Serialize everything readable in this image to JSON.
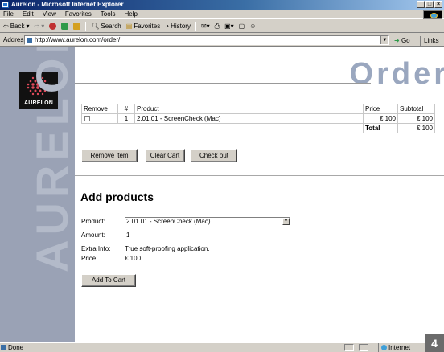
{
  "window": {
    "title": "Aurelon - Microsoft Internet Explorer",
    "controls": [
      "_",
      "□",
      "×"
    ]
  },
  "menu": [
    "File",
    "Edit",
    "View",
    "Favorites",
    "Tools",
    "Help"
  ],
  "toolbar": {
    "back": "Back",
    "search": "Search",
    "favorites": "Favorites",
    "history": "History"
  },
  "address": {
    "label": "Address",
    "url": "http://www.aurelon.com/order/",
    "go": "Go",
    "links": "Links »"
  },
  "brand": {
    "logo_text": "AURELON",
    "side_text": "AURELON",
    "colors": {
      "sidebar": "#9aa2b5",
      "title": "#9aa7bf"
    }
  },
  "page": {
    "title": "Order"
  },
  "cart": {
    "headers": [
      "Remove",
      "#",
      "Product",
      "Price",
      "Subtotal"
    ],
    "rows": [
      {
        "num": "1",
        "product": "2.01.01 - ScreenCheck (Mac)",
        "price": "€ 100",
        "subtotal": "€ 100"
      }
    ],
    "total_label": "Total",
    "total_value": "€ 100",
    "buttons": {
      "remove": "Remove item",
      "clear": "Clear Cart",
      "checkout": "Check out"
    }
  },
  "add_products": {
    "heading": "Add products",
    "product_label": "Product:",
    "product_value": "2.01.01 - ScreenCheck (Mac)",
    "amount_label": "Amount:",
    "amount_value": "1",
    "extra_label": "Extra Info:",
    "extra_value": "True soft-proofing application.",
    "price_label": "Price:",
    "price_value": "€ 100",
    "add_button": "Add To Cart"
  },
  "status": {
    "text": "Done",
    "zone": "Internet"
  },
  "page_badge": "4"
}
